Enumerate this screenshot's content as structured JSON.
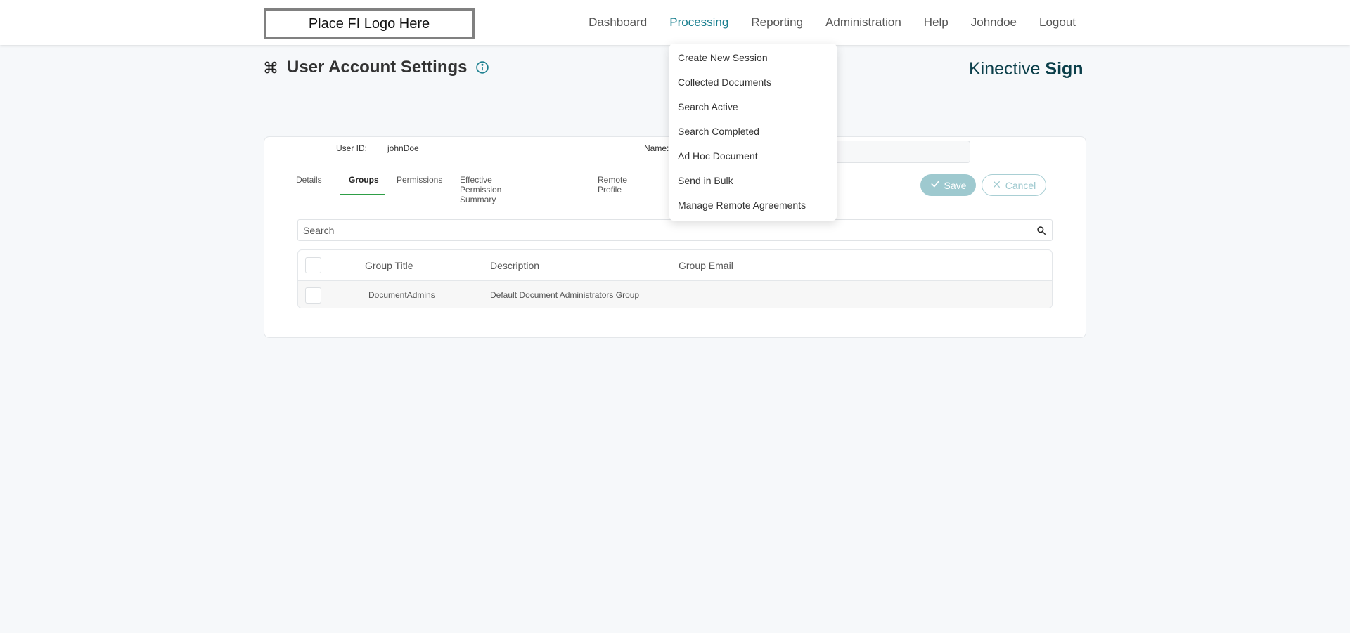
{
  "logo": {
    "text": "Place FI Logo Here"
  },
  "nav": {
    "items": [
      {
        "label": "Dashboard",
        "active": false
      },
      {
        "label": "Processing",
        "active": true
      },
      {
        "label": "Reporting",
        "active": false
      },
      {
        "label": "Administration",
        "active": false
      },
      {
        "label": "Help",
        "active": false
      },
      {
        "label": "Johndoe",
        "active": false
      },
      {
        "label": "Logout",
        "active": false
      }
    ]
  },
  "dropdown": {
    "items": [
      "Create New Session",
      "Collected Documents",
      "Search Active",
      "Search Completed",
      "Ad Hoc Document",
      "Send in Bulk",
      "Manage Remote Agreements"
    ]
  },
  "page": {
    "title": "User Account Settings",
    "title_icon": "command-icon",
    "info_icon": "info-icon"
  },
  "brand": {
    "light": "Kinective",
    "bold": "Sign"
  },
  "user": {
    "id_label": "User ID:",
    "id_value": "johnDoe",
    "name_label": "Name:"
  },
  "tabs": [
    {
      "label": "Details",
      "active": false
    },
    {
      "label": "Groups",
      "active": true
    },
    {
      "label": "Permissions",
      "active": false
    },
    {
      "label": "Effective Permission Summary",
      "active": false
    },
    {
      "label": "Remote Profile",
      "active": false
    }
  ],
  "actions": {
    "save_label": "Save",
    "cancel_label": "Cancel"
  },
  "search": {
    "placeholder": "Search"
  },
  "table": {
    "columns": [
      "Group Title",
      "Description",
      "Group Email"
    ],
    "rows": [
      {
        "title": "DocumentAdmins",
        "description": "Default Document Administrators Group",
        "email": ""
      }
    ]
  },
  "colors": {
    "accent": "#1a7f8f",
    "tab_underline": "#2e9e46",
    "save_bg": "#9ec9cf",
    "brand": "#0b3f4a"
  }
}
